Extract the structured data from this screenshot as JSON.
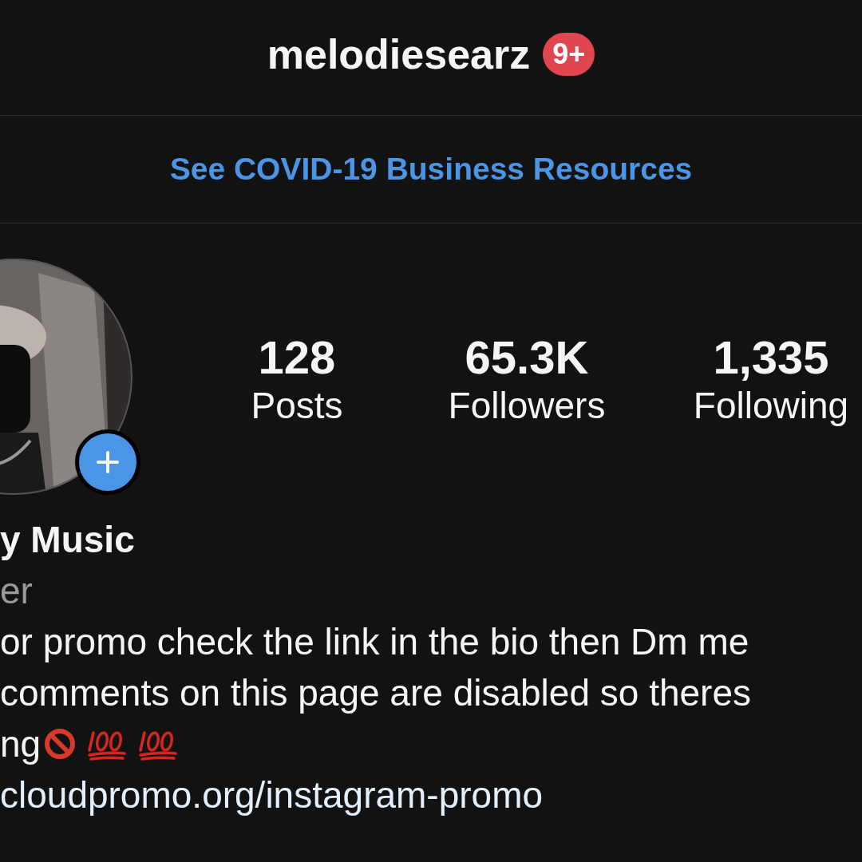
{
  "header": {
    "username": "melodiesearz",
    "badge": "9+"
  },
  "banner": {
    "link": "See COVID-19 Business Resources"
  },
  "profile": {
    "avatar": {
      "kind": "picture",
      "add_story": true
    }
  },
  "stats": [
    {
      "value": "128",
      "label": "Posts"
    },
    {
      "value": "65.3K",
      "label": "Followers"
    },
    {
      "value": "1,335",
      "label": "Following"
    }
  ],
  "bio": {
    "name": "y Music",
    "category": "er",
    "lines": [
      {
        "text": "or promo check the link in the bio then Dm me"
      },
      {
        "text": "comments on this page are disabled so theres"
      },
      {
        "text": "ng",
        "emojis": [
          {
            "kind": "prohibited"
          },
          {
            "kind": "hundred"
          },
          {
            "kind": "hundred"
          }
        ]
      }
    ],
    "website": "cloudpromo.org/instagram-promo"
  }
}
